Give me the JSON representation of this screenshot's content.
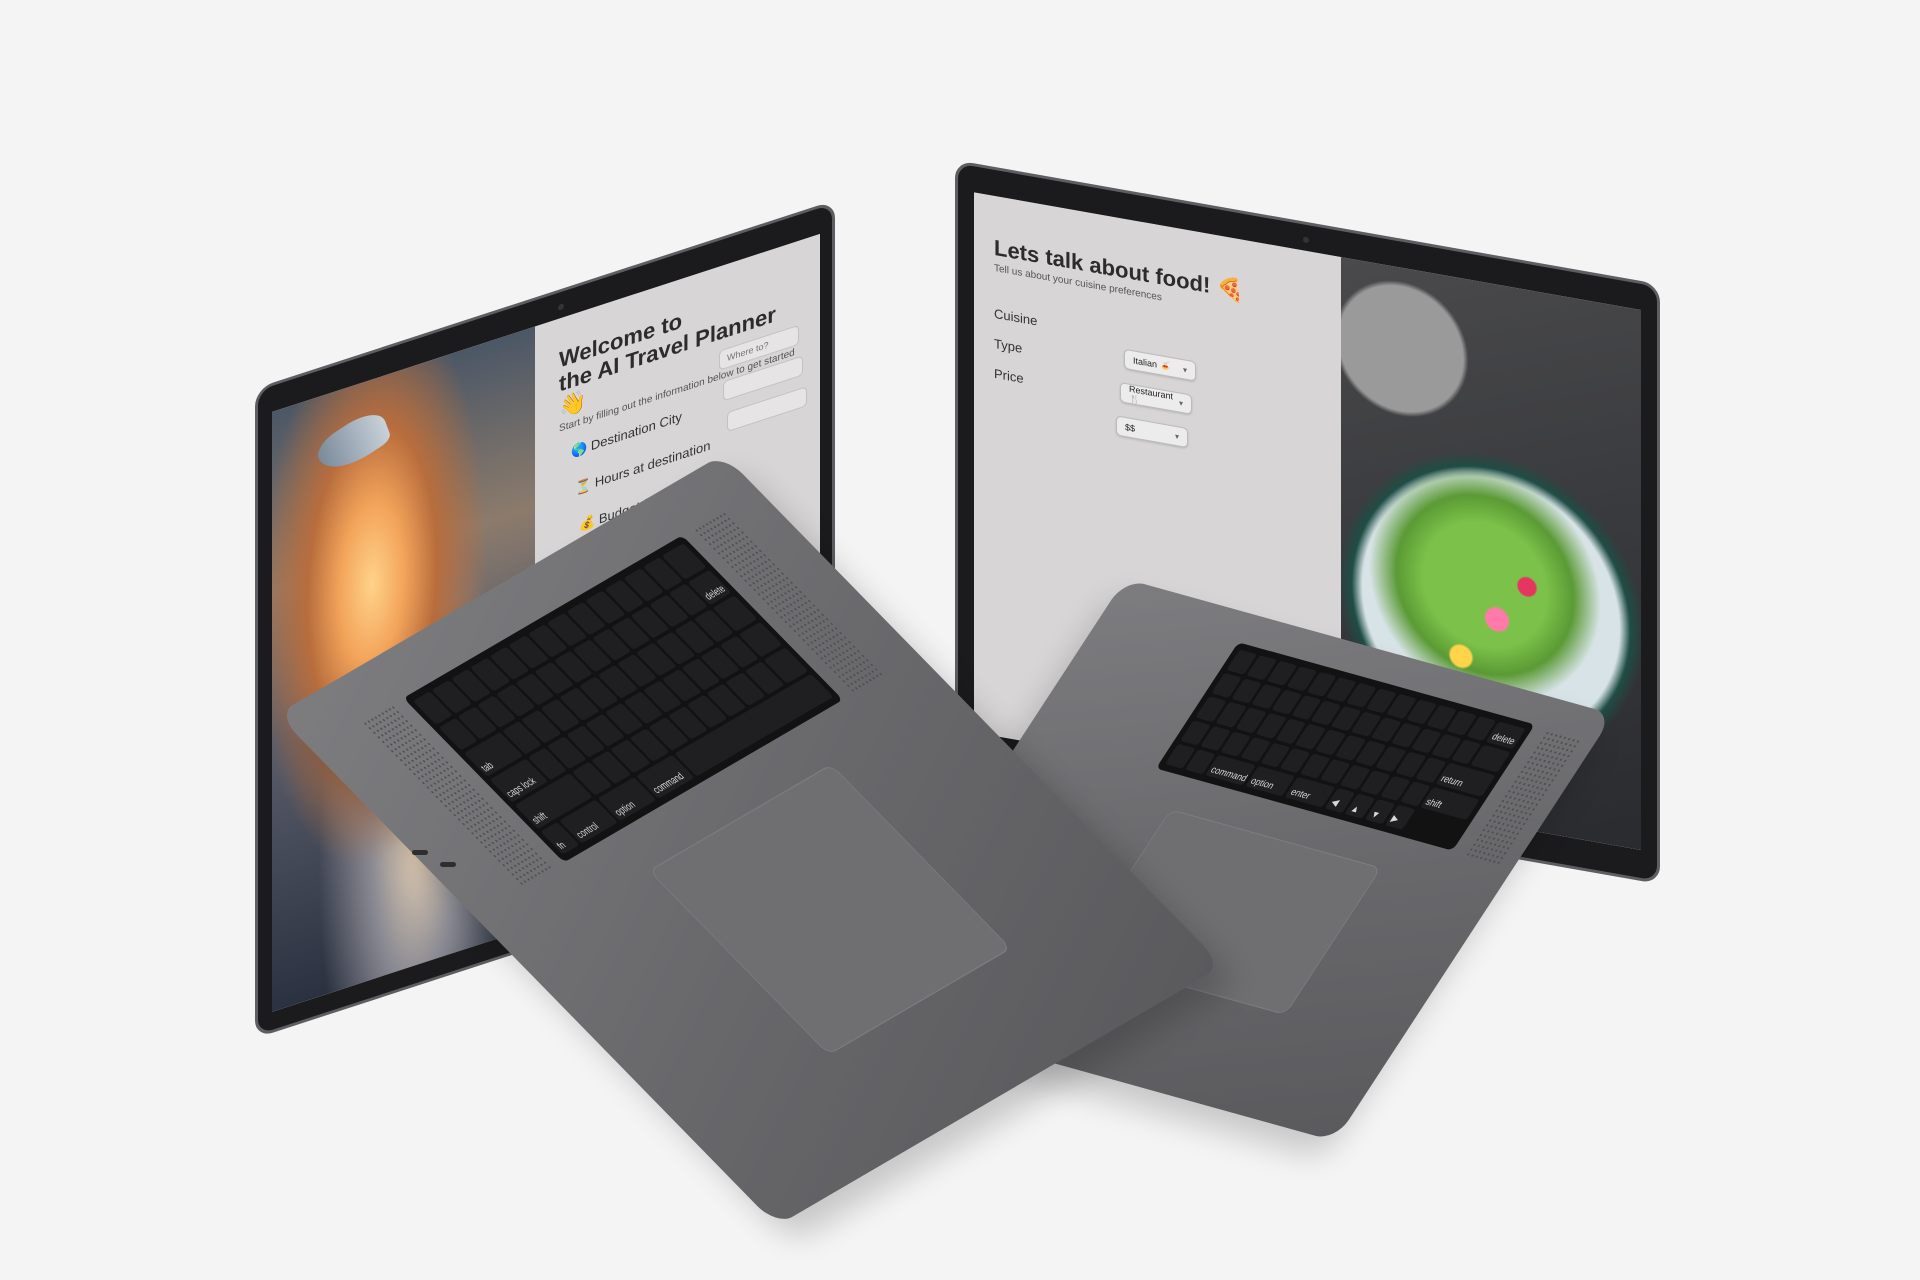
{
  "left_laptop": {
    "app": {
      "title_line1": "Welcome to",
      "title_line2": "the AI Travel Planner 👋",
      "subtitle": "Start by filling out the information below to get started",
      "fields": [
        {
          "icon": "🌎",
          "label": "Destination City",
          "placeholder": "Where to?"
        },
        {
          "icon": "⏳",
          "label": "Hours at destination",
          "placeholder": ""
        },
        {
          "icon": "💰",
          "label": "Budget for your trip ($)",
          "placeholder": ""
        }
      ]
    },
    "keys": {
      "tab": "tab",
      "caps_lock": "caps lock",
      "shift": "shift",
      "fn": "fn",
      "control": "control",
      "option": "option",
      "command": "command",
      "delete": "delete"
    }
  },
  "right_laptop": {
    "app": {
      "title": "Lets talk about food! 🍕",
      "subtitle": "Tell us about your cuisine preferences",
      "labels": {
        "cuisine": "Cuisine",
        "type": "Type",
        "price": "Price"
      },
      "selects": [
        {
          "name": "cuisine",
          "value": "Italian 🍝"
        },
        {
          "name": "type",
          "value": "Restaurant 🍴"
        },
        {
          "name": "price",
          "value": "$$"
        }
      ]
    },
    "keys": {
      "delete": "delete",
      "return": "return",
      "shift": "shift",
      "command": "command",
      "option": "option",
      "enter": "enter"
    }
  },
  "colors": {
    "background": "#f4f4f5",
    "screen_panel": "#d7d5d5",
    "laptop_body": "#6b6b6e",
    "keys": "#1f1f21"
  }
}
